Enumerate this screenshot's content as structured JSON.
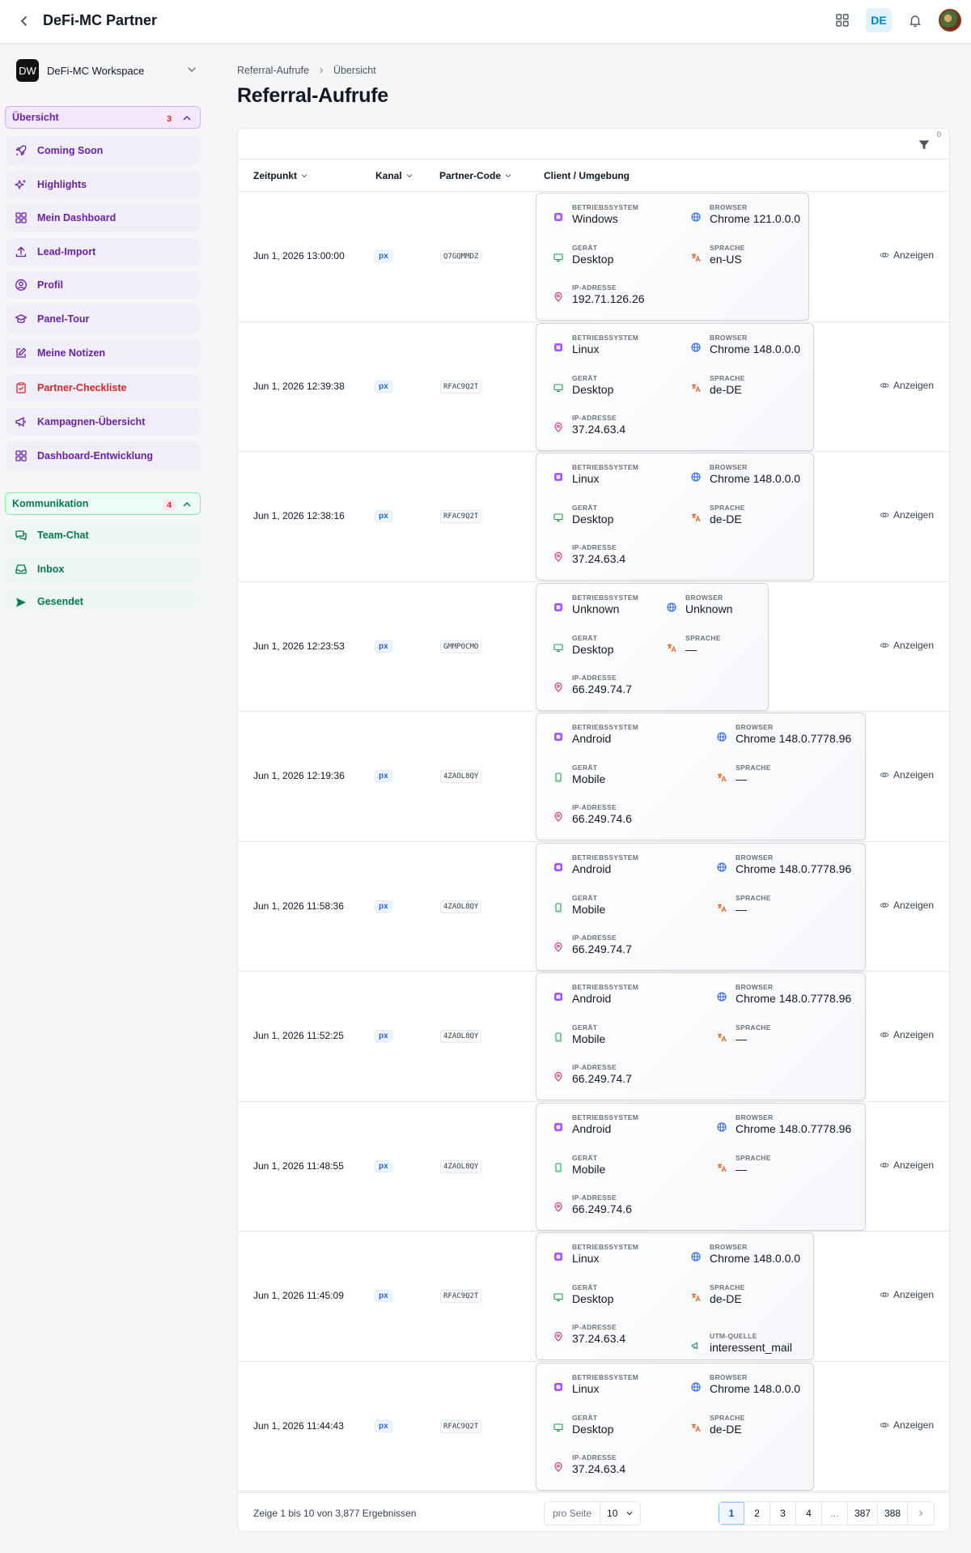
{
  "app": {
    "title": "DeFi-MC Partner",
    "language": "DE"
  },
  "workspace": {
    "logo": "DW",
    "name": "DeFi-MC Workspace"
  },
  "sidebar": {
    "groups": [
      {
        "label": "Übersicht",
        "count": "3",
        "color": "purple"
      },
      {
        "label": "Kommunikation",
        "count": "4",
        "color": "green"
      }
    ],
    "items": [
      {
        "label": "Coming Soon",
        "icon": "rocket-icon"
      },
      {
        "label": "Highlights",
        "icon": "sparkles-icon"
      },
      {
        "label": "Mein Dashboard",
        "icon": "grid-icon"
      },
      {
        "label": "Lead-Import",
        "icon": "upload-icon"
      },
      {
        "label": "Profil",
        "icon": "user-circle-icon"
      },
      {
        "label": "Panel-Tour",
        "icon": "graduation-cap-icon"
      },
      {
        "label": "Meine Notizen",
        "icon": "edit-icon"
      },
      {
        "label": "Partner-Checkliste",
        "icon": "clipboard-icon"
      },
      {
        "label": "Kampagnen-Übersicht",
        "icon": "megaphone-icon"
      },
      {
        "label": "Dashboard-Entwicklung",
        "icon": "grid-icon"
      },
      {
        "label": "Team-Chat",
        "icon": "chat-icon"
      },
      {
        "label": "Inbox",
        "icon": "inbox-icon"
      },
      {
        "label": "Gesendet",
        "icon": "send-icon"
      }
    ]
  },
  "breadcrumb": {
    "parent": "Referral-Aufrufe",
    "current": "Übersicht"
  },
  "page": {
    "title": "Referral-Aufrufe"
  },
  "filter": {
    "count": "0"
  },
  "table": {
    "columns": [
      "Zeitpunkt",
      "Kanal",
      "Partner-Code",
      "Client / Umgebung"
    ],
    "labels": {
      "os": "Betriebssystem",
      "browser": "Browser",
      "device": "Gerät",
      "language": "Sprache",
      "ip": "IP-Adresse",
      "utm": "UTM-Quelle",
      "action": "Anzeigen"
    },
    "rows": [
      {
        "time": "Jun 1, 2026 13:00:00",
        "kanal": "px",
        "code": "Q7GQMMDZ",
        "os": "Windows",
        "browser": "Chrome 121.0.0.0",
        "device": "Desktop",
        "language": "en-US",
        "ip": "192.71.126.26",
        "utm": ""
      },
      {
        "time": "Jun 1, 2026 12:39:38",
        "kanal": "px",
        "code": "RFAC9Q2T",
        "os": "Linux",
        "browser": "Chrome 148.0.0.0",
        "device": "Desktop",
        "language": "de-DE",
        "ip": "37.24.63.4",
        "utm": ""
      },
      {
        "time": "Jun 1, 2026 12:38:16",
        "kanal": "px",
        "code": "RFAC9Q2T",
        "os": "Linux",
        "browser": "Chrome 148.0.0.0",
        "device": "Desktop",
        "language": "de-DE",
        "ip": "37.24.63.4",
        "utm": ""
      },
      {
        "time": "Jun 1, 2026 12:23:53",
        "kanal": "px",
        "code": "GMMPOCMO",
        "os": "Unknown",
        "browser": "Unknown",
        "device": "Desktop",
        "language": "—",
        "ip": "66.249.74.7",
        "utm": ""
      },
      {
        "time": "Jun 1, 2026 12:19:36",
        "kanal": "px",
        "code": "4ZAOL8QY",
        "os": "Android",
        "browser": "Chrome 148.0.7778.96",
        "device": "Mobile",
        "language": "—",
        "ip": "66.249.74.6",
        "utm": ""
      },
      {
        "time": "Jun 1, 2026 11:58:36",
        "kanal": "px",
        "code": "4ZAOL8QY",
        "os": "Android",
        "browser": "Chrome 148.0.7778.96",
        "device": "Mobile",
        "language": "—",
        "ip": "66.249.74.7",
        "utm": ""
      },
      {
        "time": "Jun 1, 2026 11:52:25",
        "kanal": "px",
        "code": "4ZAOL8QY",
        "os": "Android",
        "browser": "Chrome 148.0.7778.96",
        "device": "Mobile",
        "language": "—",
        "ip": "66.249.74.7",
        "utm": ""
      },
      {
        "time": "Jun 1, 2026 11:48:55",
        "kanal": "px",
        "code": "4ZAOL8QY",
        "os": "Android",
        "browser": "Chrome 148.0.7778.96",
        "device": "Mobile",
        "language": "—",
        "ip": "66.249.74.6",
        "utm": ""
      },
      {
        "time": "Jun 1, 2026 11:45:09",
        "kanal": "px",
        "code": "RFAC9Q2T",
        "os": "Linux",
        "browser": "Chrome 148.0.0.0",
        "device": "Desktop",
        "language": "de-DE",
        "ip": "37.24.63.4",
        "utm": "interessent_mail"
      },
      {
        "time": "Jun 1, 2026 11:44:43",
        "kanal": "px",
        "code": "RFAC9Q2T",
        "os": "Linux",
        "browser": "Chrome 148.0.0.0",
        "device": "Desktop",
        "language": "de-DE",
        "ip": "37.24.63.4",
        "utm": ""
      }
    ]
  },
  "footer": {
    "result_text": "Zeige 1 bis 10 von 3,877 Ergebnissen",
    "per_page_label": "pro Seite",
    "per_page_value": "10",
    "pages": [
      "1",
      "2",
      "3",
      "4",
      "...",
      "387",
      "388"
    ],
    "current_page": "1"
  },
  "colors": {
    "purple_accent": "#6b21a8",
    "green_accent": "#047857",
    "red_accent": "#dc2626",
    "blue_accent": "#2563eb"
  }
}
